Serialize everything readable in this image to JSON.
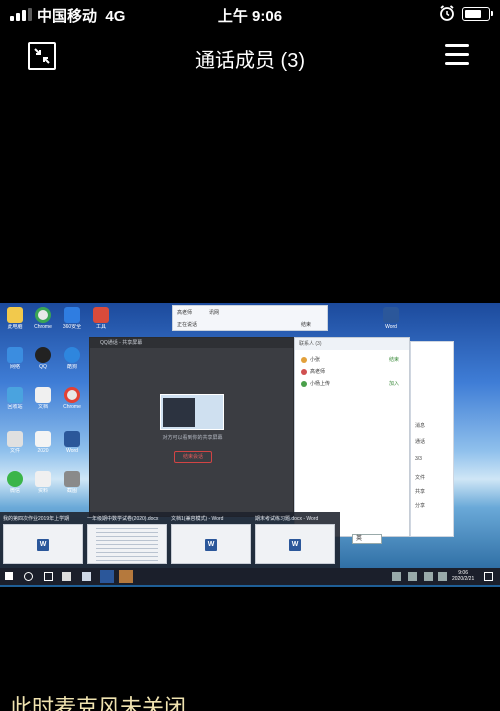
{
  "status_bar": {
    "carrier": "中国移动",
    "network": "4G",
    "time": "上午 9:06",
    "battery_level": 0.78
  },
  "call": {
    "title": "通话成员 (3)",
    "icons": {
      "collapse": "collapse-arrows-icon",
      "menu": "hamburger-menu-icon"
    }
  },
  "shared_screen": {
    "popup": {
      "name_a": "高老师",
      "name_b": "讯网",
      "line": "正在说话",
      "end": "结束"
    },
    "meeting": {
      "title": "QQ通话 - 共享屏幕",
      "caption": "对方可以看到你的共享屏幕",
      "end_label": "结束会话"
    },
    "contacts": {
      "header": "联系人 (3)",
      "rows": [
        {
          "name": "小张",
          "action": "结束",
          "color": "#e2a03a"
        },
        {
          "name": "高老师",
          "action": "",
          "color": "#d05050"
        },
        {
          "name": "小杨上传",
          "action": "加入",
          "color": "#4aa04a"
        }
      ]
    },
    "side_panel": {
      "page": "3/3",
      "lines": [
        "消息",
        "通话",
        "文件",
        "共享",
        "分享"
      ]
    },
    "thumbnails": [
      {
        "title": "我的第四次作业2019年上学期",
        "kind": "word"
      },
      {
        "title": "一年级期中数学试卷(2020).docx",
        "kind": "doc"
      },
      {
        "title": "文档1(兼容模式) - Word",
        "kind": "word"
      },
      {
        "title": "期末考试练习题.docx - Word",
        "kind": "word"
      }
    ],
    "ime": "英",
    "tray": {
      "time": "9:06",
      "date": "2020/2/21"
    }
  },
  "bottom_caption": "此时麦克风未关闭"
}
